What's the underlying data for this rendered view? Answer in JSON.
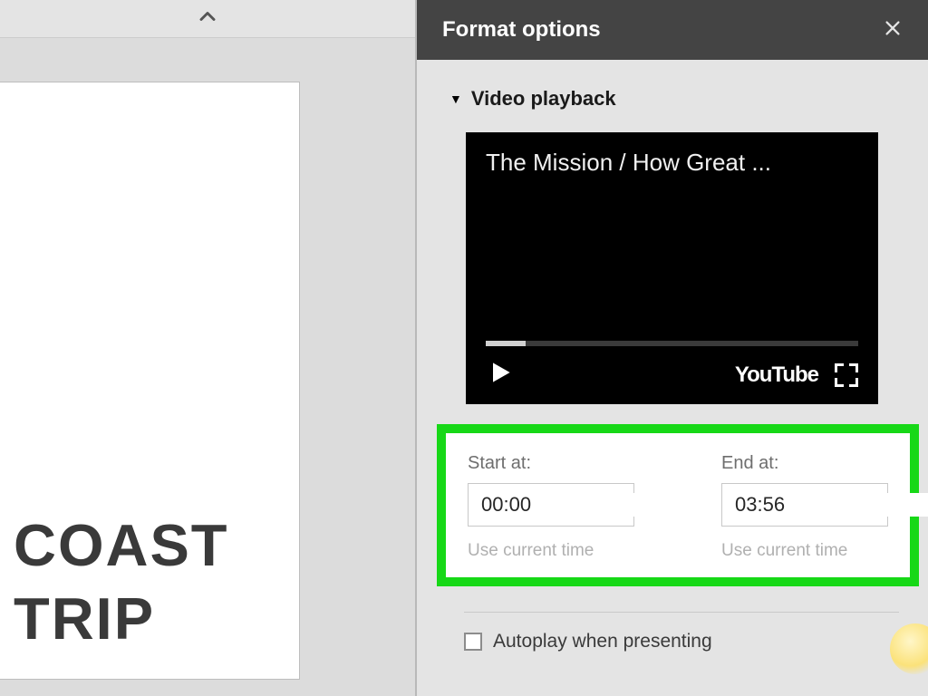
{
  "slide": {
    "title_line1": "COAST",
    "title_line2": "TRIP"
  },
  "panel": {
    "title": "Format options"
  },
  "section": {
    "title": "Video playback"
  },
  "video": {
    "title": "The Mission / How Great ...",
    "provider": "YouTube"
  },
  "time": {
    "start_label": "Start at:",
    "start_value": "00:00",
    "end_label": "End at:",
    "end_value": "03:56",
    "hint": "Use current time"
  },
  "autoplay": {
    "label": "Autoplay when presenting",
    "checked": false
  }
}
